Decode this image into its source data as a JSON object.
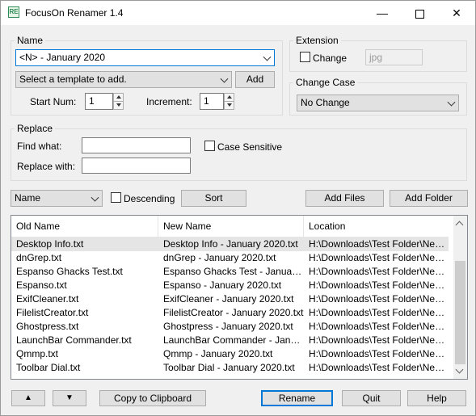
{
  "window": {
    "title": "FocusOn Renamer 1.4",
    "icon_text": "RE",
    "minimize_icon": "minimize-icon",
    "maximize_icon": "maximize-icon",
    "close_icon": "close-icon"
  },
  "name_group": {
    "legend": "Name",
    "pattern": "<N> - January 2020",
    "template_placeholder": "Select a template to add.",
    "add_label": "Add",
    "start_num_label": "Start Num:",
    "start_num_value": "1",
    "increment_label": "Increment:",
    "increment_value": "1"
  },
  "extension_group": {
    "legend": "Extension",
    "change_label": "Change",
    "change_checked": false,
    "ext_value": "jpg"
  },
  "change_case_group": {
    "legend": "Change Case",
    "selected": "No Change"
  },
  "replace_group": {
    "legend": "Replace",
    "find_label": "Find what:",
    "find_value": "",
    "case_sensitive_label": "Case Sensitive",
    "replace_label": "Replace with:",
    "replace_value": ""
  },
  "sort_bar": {
    "sort_by": "Name",
    "descending_label": "Descending",
    "sort_label": "Sort",
    "add_files_label": "Add Files",
    "add_folder_label": "Add Folder"
  },
  "file_list": {
    "columns": [
      "Old Name",
      "New Name",
      "Location"
    ],
    "rows": [
      [
        "Desktop Info.txt",
        "Desktop Info - January 2020.txt",
        "H:\\Downloads\\Test Folder\\New ..."
      ],
      [
        "dnGrep.txt",
        "dnGrep - January 2020.txt",
        "H:\\Downloads\\Test Folder\\New ..."
      ],
      [
        "Espanso Ghacks Test.txt",
        "Espanso Ghacks Test - January ...",
        "H:\\Downloads\\Test Folder\\New ..."
      ],
      [
        "Espanso.txt",
        "Espanso - January 2020.txt",
        "H:\\Downloads\\Test Folder\\New ..."
      ],
      [
        "ExifCleaner.txt",
        "ExifCleaner - January 2020.txt",
        "H:\\Downloads\\Test Folder\\New ..."
      ],
      [
        "FilelistCreator.txt",
        "FilelistCreator - January 2020.txt",
        "H:\\Downloads\\Test Folder\\New ..."
      ],
      [
        "Ghostpress.txt",
        "Ghostpress - January 2020.txt",
        "H:\\Downloads\\Test Folder\\New ..."
      ],
      [
        "LaunchBar Commander.txt",
        "LaunchBar Commander - Januar...",
        "H:\\Downloads\\Test Folder\\New ..."
      ],
      [
        "Qmmp.txt",
        "Qmmp - January 2020.txt",
        "H:\\Downloads\\Test Folder\\New ..."
      ],
      [
        "Toolbar Dial.txt",
        "Toolbar Dial - January 2020.txt",
        "H:\\Downloads\\Test Folder\\New ..."
      ]
    ],
    "selected_row": 0
  },
  "bottom_bar": {
    "up_label": "▲",
    "down_label": "▼",
    "copy_label": "Copy to Clipboard",
    "rename_label": "Rename",
    "quit_label": "Quit",
    "help_label": "Help"
  }
}
